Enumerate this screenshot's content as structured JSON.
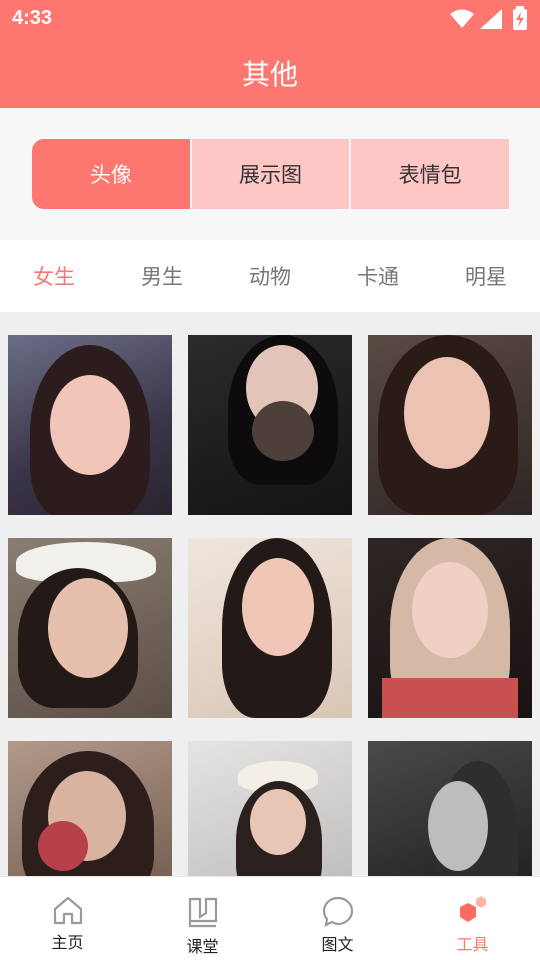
{
  "status_bar": {
    "time": "4:33"
  },
  "header": {
    "title": "其他"
  },
  "segments": [
    {
      "label": "头像",
      "active": true
    },
    {
      "label": "展示图",
      "active": false
    },
    {
      "label": "表情包",
      "active": false
    }
  ],
  "categories": [
    {
      "label": "女生",
      "active": true
    },
    {
      "label": "男生",
      "active": false
    },
    {
      "label": "动物",
      "active": false
    },
    {
      "label": "卡通",
      "active": false
    },
    {
      "label": "明星",
      "active": false
    }
  ],
  "tabbar": [
    {
      "label": "主页",
      "icon": "home-icon",
      "active": false
    },
    {
      "label": "课堂",
      "icon": "book-icon",
      "active": false
    },
    {
      "label": "图文",
      "icon": "chat-bubble-icon",
      "active": false
    },
    {
      "label": "工具",
      "icon": "toolbox-hexagon-icon",
      "active": true
    }
  ],
  "colors": {
    "accent": "#fd7670",
    "segment_inactive": "#ffc6c6"
  }
}
